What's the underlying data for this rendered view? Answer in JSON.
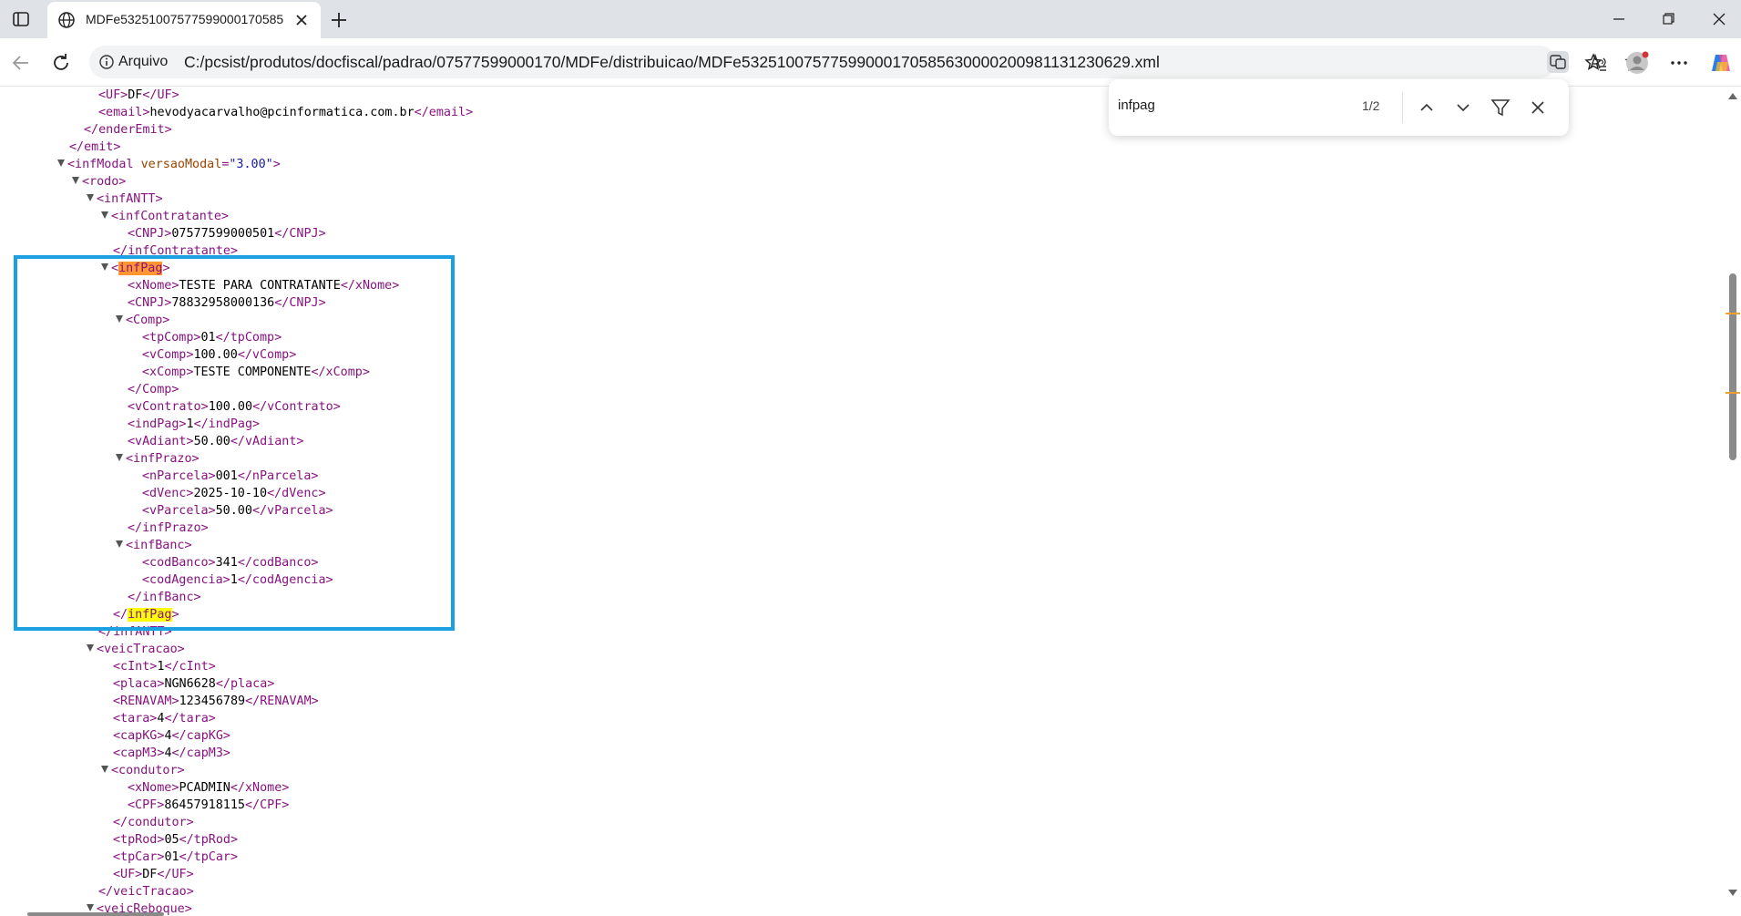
{
  "browser": {
    "tab_title": "MDFe53251007577599000170585",
    "search_query": "infpag",
    "match_count": "1/2",
    "address_scheme": "Arquivo",
    "address_url": "C:/pcsist/produtos/docfiscal/padrao/07577599000170/MDFe/distribuicao/MDFe53251007577599000170585630000200981131230629.xml"
  },
  "xml": {
    "uf_emit": "DF",
    "email": "hevodyacarvalho@pcinformatica.com.br",
    "versao_modal": "\"3.00\"",
    "contratante_cnpj": "07577599000501",
    "pag_xnome": "TESTE PARA CONTRATANTE",
    "pag_cnpj": "78832958000136",
    "tp_comp": "01",
    "v_comp": "100.00",
    "x_comp": "TESTE COMPONENTE",
    "v_contrato": "100.00",
    "ind_pag": "1",
    "v_adiant": "50.00",
    "n_parcela": "001",
    "d_venc": "2025-10-10",
    "v_parcela": "50.00",
    "cod_banco": "341",
    "cod_agencia": "1",
    "c_int": "1",
    "placa": "NGN6628",
    "renavam": "123456789",
    "tara": "4",
    "cap_kg": "4",
    "cap_m3": "4",
    "condutor_xnome": "PCADMIN",
    "condutor_cpf": "86457918115",
    "tp_rod": "05",
    "tp_car": "01",
    "uf_veic": "DF"
  },
  "icons": [
    "tab-actions-icon",
    "globe-icon",
    "close-icon",
    "plus-icon",
    "minimize-icon",
    "maximize-icon",
    "back-arrow-icon",
    "reload-icon",
    "info-icon",
    "translate-icon",
    "read-aloud-icon",
    "star-icon",
    "favorites-icon",
    "profile-icon",
    "more-icon",
    "copilot-icon",
    "chevron-up-icon",
    "chevron-down-icon",
    "filter-icon"
  ],
  "colors": {
    "tag": "#881280",
    "attribute": "#994500",
    "attribute_value": "#1a1aa6",
    "current_match": "#ff9632",
    "other_match": "#ffff00",
    "annotation_box": "#1ba1e2"
  }
}
